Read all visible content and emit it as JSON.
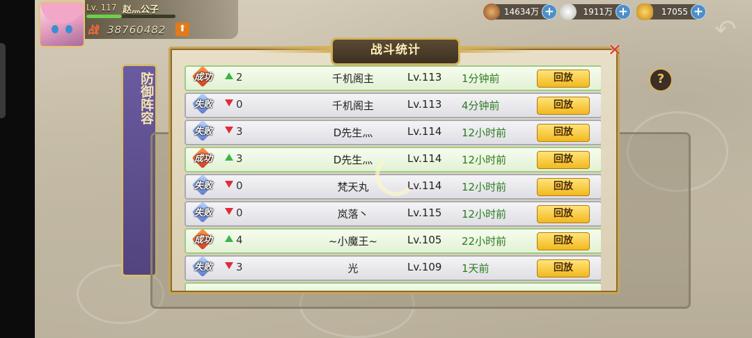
{
  "player": {
    "level": "Lv. 117",
    "name": "赵灬公子",
    "power_label": "战",
    "power": "38760482",
    "xp_progress": 0.4
  },
  "resources": [
    {
      "icon": "copper-coin-icon",
      "value": "14634万"
    },
    {
      "icon": "rice-icon",
      "value": "1911万"
    },
    {
      "icon": "gold-ingot-icon",
      "value": "17055"
    }
  ],
  "side_tab": {
    "label": "防御阵容"
  },
  "dialog": {
    "title": "战斗统计",
    "rows": [
      {
        "result": "win",
        "badge": "成功",
        "change": "up",
        "rank_change": "2",
        "name": "千机阁主",
        "level": "Lv.113",
        "time": "1分钟前",
        "replay": "回放"
      },
      {
        "result": "loss",
        "badge": "失败",
        "change": "down",
        "rank_change": "0",
        "name": "千机阁主",
        "level": "Lv.113",
        "time": "4分钟前",
        "replay": "回放"
      },
      {
        "result": "loss",
        "badge": "失败",
        "change": "down",
        "rank_change": "3",
        "name": "D先生灬",
        "level": "Lv.114",
        "time": "12小时前",
        "replay": "回放"
      },
      {
        "result": "win",
        "badge": "成功",
        "change": "up",
        "rank_change": "3",
        "name": "D先生灬",
        "level": "Lv.114",
        "time": "12小时前",
        "replay": "回放"
      },
      {
        "result": "loss",
        "badge": "失败",
        "change": "down",
        "rank_change": "0",
        "name": "梵天丸",
        "level": "Lv.114",
        "time": "12小时前",
        "replay": "回放"
      },
      {
        "result": "loss",
        "badge": "失败",
        "change": "down",
        "rank_change": "0",
        "name": "岚落丶",
        "level": "Lv.115",
        "time": "12小时前",
        "replay": "回放"
      },
      {
        "result": "win",
        "badge": "成功",
        "change": "up",
        "rank_change": "4",
        "name": "~小魔王~",
        "level": "Lv.105",
        "time": "22小时前",
        "replay": "回放"
      },
      {
        "result": "loss",
        "badge": "失败",
        "change": "down",
        "rank_change": "3",
        "name": "光",
        "level": "Lv.109",
        "time": "1天前",
        "replay": "回放"
      }
    ]
  }
}
